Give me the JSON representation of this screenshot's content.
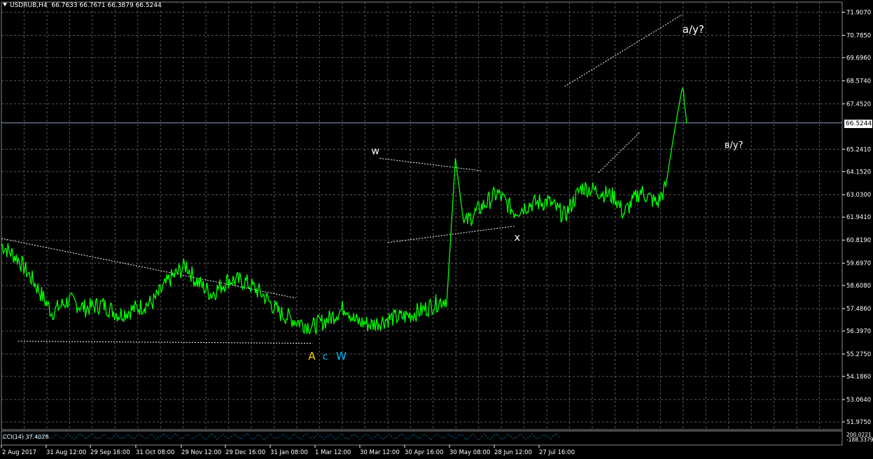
{
  "header": {
    "symbol": "USDRUB,H4",
    "ohlc": "66.7633 66.7671 66.3879 66.5244"
  },
  "current_price": "66.5244",
  "indicator_label": "CCI(14) 37.4028",
  "colors": {
    "background": "#000000",
    "grid": "#5a5a5a",
    "price_line": "#00ff00",
    "trendline": "#ffffff",
    "label_A": "#ffd700",
    "label_c": "#00bfff",
    "label_W": "#00bfff",
    "indicator": "#00bfff"
  },
  "chart_data": {
    "type": "line",
    "title": "USDRUB,H4",
    "y_ticks": [
      "71.9070",
      "70.7850",
      "69.6960",
      "68.5740",
      "67.4520",
      "66.5244",
      "65.2410",
      "64.1520",
      "63.0300",
      "61.9410",
      "60.8190",
      "59.6970",
      "58.6080",
      "57.4860",
      "56.3970",
      "55.2750",
      "54.1860",
      "53.0640",
      "51.9750"
    ],
    "x_ticks": [
      "2 Aug 2017",
      "31 Aug 12:00",
      "29 Sep 16:00",
      "31 Oct 08:00",
      "29 Nov 12:00",
      "29 Dec 16:00",
      "31 Jan 08:00",
      "1 Mar 12:00",
      "30 Mar 12:00",
      "30 Apr 16:00",
      "30 May 08:00",
      "28 Jun 12:00",
      "27 Jul 16:00"
    ],
    "ylim": [
      51.6,
      72.4
    ],
    "indicator_ticks": [
      "200.0221",
      "-188.3379"
    ],
    "annotations": [
      {
        "text": "a/y?",
        "color": "#ffffff"
      },
      {
        "text": "w",
        "color": "#ffffff"
      },
      {
        "text": "в/y?",
        "color": "#ffffff"
      },
      {
        "text": "x",
        "color": "#ffffff"
      },
      {
        "text": "A",
        "color": "#ffd700"
      },
      {
        "text": "c",
        "color": "#00bfff"
      },
      {
        "text": "W",
        "color": "#00bfff"
      }
    ],
    "price_path": [
      [
        0,
        60.6
      ],
      [
        0.02,
        59.9
      ],
      [
        0.04,
        58.7
      ],
      [
        0.06,
        57.3
      ],
      [
        0.08,
        57.9
      ],
      [
        0.1,
        57.5
      ],
      [
        0.12,
        57.7
      ],
      [
        0.14,
        57.2
      ],
      [
        0.16,
        57.5
      ],
      [
        0.18,
        57.8
      ],
      [
        0.2,
        58.9
      ],
      [
        0.22,
        59.6
      ],
      [
        0.23,
        58.9
      ],
      [
        0.25,
        58.2
      ],
      [
        0.27,
        58.9
      ],
      [
        0.29,
        58.8
      ],
      [
        0.31,
        58.2
      ],
      [
        0.33,
        57.3
      ],
      [
        0.35,
        56.9
      ],
      [
        0.37,
        56.6
      ],
      [
        0.39,
        57.0
      ],
      [
        0.41,
        57.6
      ],
      [
        0.42,
        56.9
      ],
      [
        0.44,
        56.7
      ],
      [
        0.46,
        57.0
      ],
      [
        0.48,
        57.1
      ],
      [
        0.5,
        57.4
      ],
      [
        0.52,
        57.8
      ],
      [
        0.53,
        58.0
      ],
      [
        0.54,
        64.8
      ],
      [
        0.55,
        61.6
      ],
      [
        0.57,
        62.4
      ],
      [
        0.59,
        63.1
      ],
      [
        0.61,
        62.2
      ],
      [
        0.63,
        62.6
      ],
      [
        0.65,
        62.7
      ],
      [
        0.67,
        62.0
      ],
      [
        0.69,
        63.4
      ],
      [
        0.71,
        63.2
      ],
      [
        0.73,
        62.9
      ],
      [
        0.74,
        62.1
      ],
      [
        0.76,
        63.2
      ],
      [
        0.78,
        62.6
      ],
      [
        0.79,
        63.4
      ],
      [
        0.8,
        66.0
      ],
      [
        0.81,
        68.3
      ],
      [
        0.815,
        66.5
      ]
    ]
  }
}
